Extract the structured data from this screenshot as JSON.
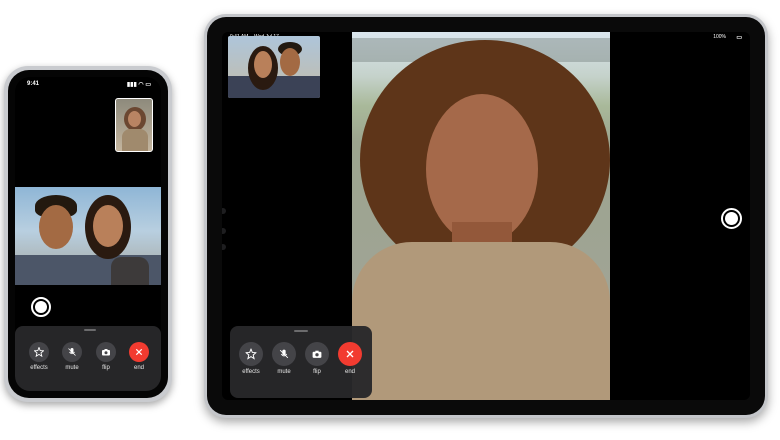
{
  "iphone": {
    "status_time": "9:41",
    "controls": [
      {
        "label": "effects",
        "icon": "star-icon"
      },
      {
        "label": "mute",
        "icon": "mic-slash-icon"
      },
      {
        "label": "flip",
        "icon": "camera-icon"
      },
      {
        "label": "end",
        "icon": "x-icon"
      }
    ]
  },
  "ipad": {
    "status_time": "9:41 AM",
    "status_date": "Wed Jul 17",
    "battery": "100%",
    "controls": [
      {
        "label": "effects",
        "icon": "star-icon"
      },
      {
        "label": "mute",
        "icon": "mic-slash-icon"
      },
      {
        "label": "flip",
        "icon": "camera-icon"
      },
      {
        "label": "end",
        "icon": "x-icon"
      }
    ]
  },
  "colors": {
    "end_button": "#f23b30",
    "control_button": "#444448",
    "panel": "#28282a"
  }
}
